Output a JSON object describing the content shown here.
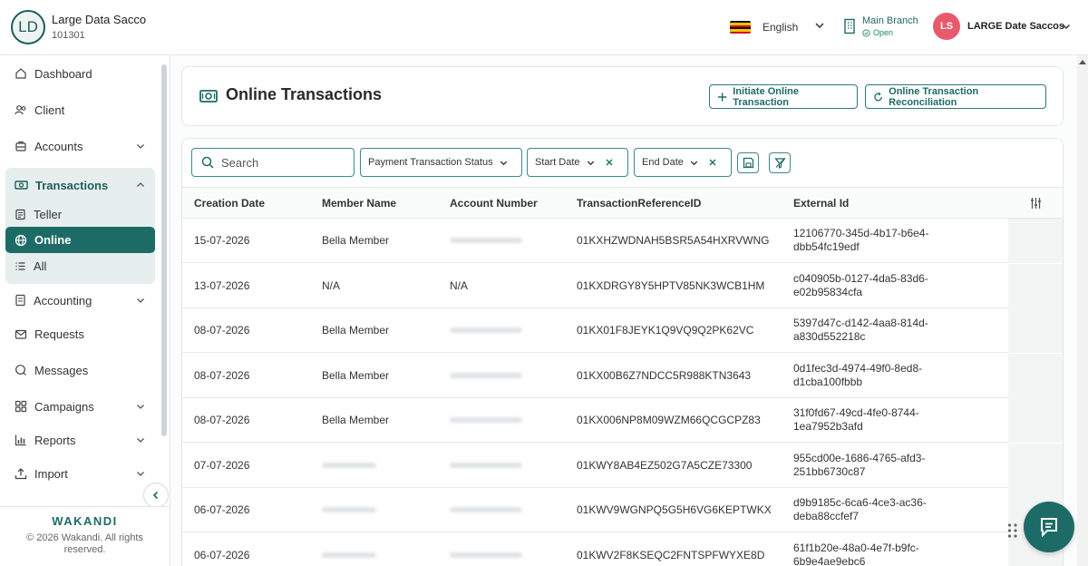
{
  "header": {
    "org_initials": "LD",
    "org_name": "Large Data Sacco",
    "org_code": "101301",
    "language": "English",
    "branch_name": "Main Branch",
    "branch_status": "Open",
    "user_initials": "LS",
    "user_name": "LARGE Date Saccos"
  },
  "sidebar": {
    "items": [
      {
        "label": "Dashboard",
        "icon": "home-icon"
      },
      {
        "label": "Client",
        "icon": "users-icon"
      },
      {
        "label": "Accounts",
        "icon": "bank-icon"
      },
      {
        "label": "Transactions",
        "icon": "cash-icon"
      },
      {
        "label": "Teller",
        "icon": "teller-icon"
      },
      {
        "label": "Online",
        "icon": "globe-icon"
      },
      {
        "label": "All",
        "icon": "list-icon"
      },
      {
        "label": "Accounting",
        "icon": "ledger-icon"
      },
      {
        "label": "Requests",
        "icon": "mail-icon"
      },
      {
        "label": "Messages",
        "icon": "chat-icon"
      },
      {
        "label": "Campaigns",
        "icon": "grid-icon"
      },
      {
        "label": "Reports",
        "icon": "bar-chart-icon"
      },
      {
        "label": "Import",
        "icon": "upload-icon"
      }
    ],
    "brand": "WAKANDI",
    "copyright": "© 2026 Wakandi. All rights reserved."
  },
  "page": {
    "title": "Online Transactions",
    "initiate_label": "Initiate Online Transaction",
    "reconcile_label": "Online Transaction Reconciliation"
  },
  "filters": {
    "search_placeholder": "Search",
    "status_label": "Payment Transaction Status",
    "start_label": "Start Date",
    "end_label": "End Date"
  },
  "table": {
    "columns": [
      "Creation Date",
      "Member Name",
      "Account Number",
      "TransactionReferenceID",
      "External Id"
    ],
    "rows": [
      {
        "date": "15-07-2026",
        "member": "Bella Member",
        "account": "",
        "ref": "01KXHZWDNAH5BSR5A54HXRVWNG",
        "ext1": "12106770-345d-4b17-b6e4-",
        "ext2": "dbb54fc19edf"
      },
      {
        "date": "13-07-2026",
        "member": "N/A",
        "account": "N/A",
        "ref": "01KXDRGY8Y5HPTV85NK3WCB1HM",
        "ext1": "c040905b-0127-4da5-83d6-",
        "ext2": "e02b95834cfa"
      },
      {
        "date": "08-07-2026",
        "member": "Bella Member",
        "account": "",
        "ref": "01KX01F8JEYK1Q9VQ9Q2PK62VC",
        "ext1": "5397d47c-d142-4aa8-814d-",
        "ext2": "a830d552218c"
      },
      {
        "date": "08-07-2026",
        "member": "Bella Member",
        "account": "",
        "ref": "01KX00B6Z7NDCC5R988KTN3643",
        "ext1": "0d1fec3d-4974-49f0-8ed8-",
        "ext2": "d1cba100fbbb"
      },
      {
        "date": "08-07-2026",
        "member": "Bella Member",
        "account": "",
        "ref": "01KX006NP8M09WZM66QCGCPZ83",
        "ext1": "31f0fd67-49cd-4fe0-8744-",
        "ext2": "1ea7952b3afd"
      },
      {
        "date": "07-07-2026",
        "member": "",
        "account": "",
        "ref": "01KWY8AB4EZ502G7A5CZE73300",
        "ext1": "955cd00e-1686-4765-afd3-",
        "ext2": "251bb6730c87"
      },
      {
        "date": "06-07-2026",
        "member": "",
        "account": "",
        "ref": "01KWV9WGNPQ5G5H6VG6KEPTWKX",
        "ext1": "d9b9185c-6ca6-4ce3-ac36-",
        "ext2": "deba88ccfef7"
      },
      {
        "date": "06-07-2026",
        "member": "",
        "account": "",
        "ref": "01KWV2F8KSEQC2FNTSPFWYXE8D",
        "ext1": "61f1b20e-48a0-4e7f-b9fc-",
        "ext2": "6b9e4ae9ebc6"
      }
    ]
  },
  "colors": {
    "primary": "#1d6b67",
    "active_bg": "#e6efee",
    "avatar": "#e85a6b"
  }
}
